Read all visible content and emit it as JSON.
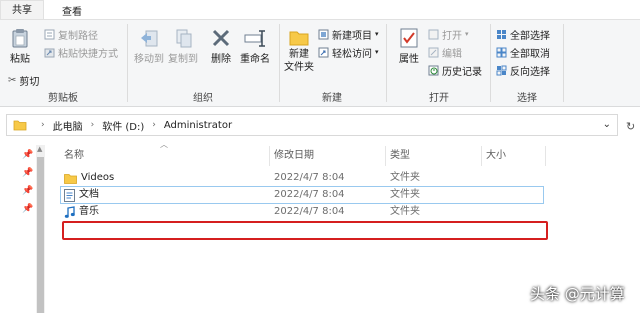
{
  "tabs": [
    {
      "label": "共享"
    },
    {
      "label": "查看"
    }
  ],
  "ribbon": {
    "clipboard": {
      "paste": "粘贴",
      "cut": "剪切",
      "copy_path": "复制路径",
      "paste_shortcut": "粘贴快捷方式",
      "group_label": "剪贴板"
    },
    "organize": {
      "move_to": "移动到",
      "copy_to": "复制到",
      "delete": "删除",
      "rename": "重命名",
      "group_label": "组织"
    },
    "new": {
      "new_folder_line1": "新建",
      "new_folder_line2": "文件夹",
      "new_item": "新建项目",
      "easy_access": "轻松访问",
      "group_label": "新建"
    },
    "open": {
      "properties": "属性",
      "open": "打开",
      "edit": "编辑",
      "history": "历史记录",
      "group_label": "打开"
    },
    "select": {
      "select_all": "全部选择",
      "select_none": "全部取消",
      "invert": "反向选择",
      "group_label": "选择"
    }
  },
  "address": {
    "crumbs": [
      "此电脑",
      "软件 (D:)",
      "Administrator"
    ]
  },
  "columns": {
    "name": "名称",
    "modified": "修改日期",
    "type": "类型",
    "size": "大小"
  },
  "files": [
    {
      "name": "Videos",
      "modified": "2022/4/7 8:04",
      "type": "文件夹",
      "icon": "folder-icon"
    },
    {
      "name": "文档",
      "modified": "2022/4/7 8:04",
      "type": "文件夹",
      "icon": "documents-icon"
    },
    {
      "name": "音乐",
      "modified": "2022/4/7 8:04",
      "type": "文件夹",
      "icon": "music-icon"
    }
  ],
  "watermark": "头条 @元计算",
  "colors": {
    "ribbon_bg": "#f5f6f7",
    "selection_border": "#99c9ef",
    "highlight_red": "#d51f1f",
    "folder_yellow": "#f7c948"
  }
}
